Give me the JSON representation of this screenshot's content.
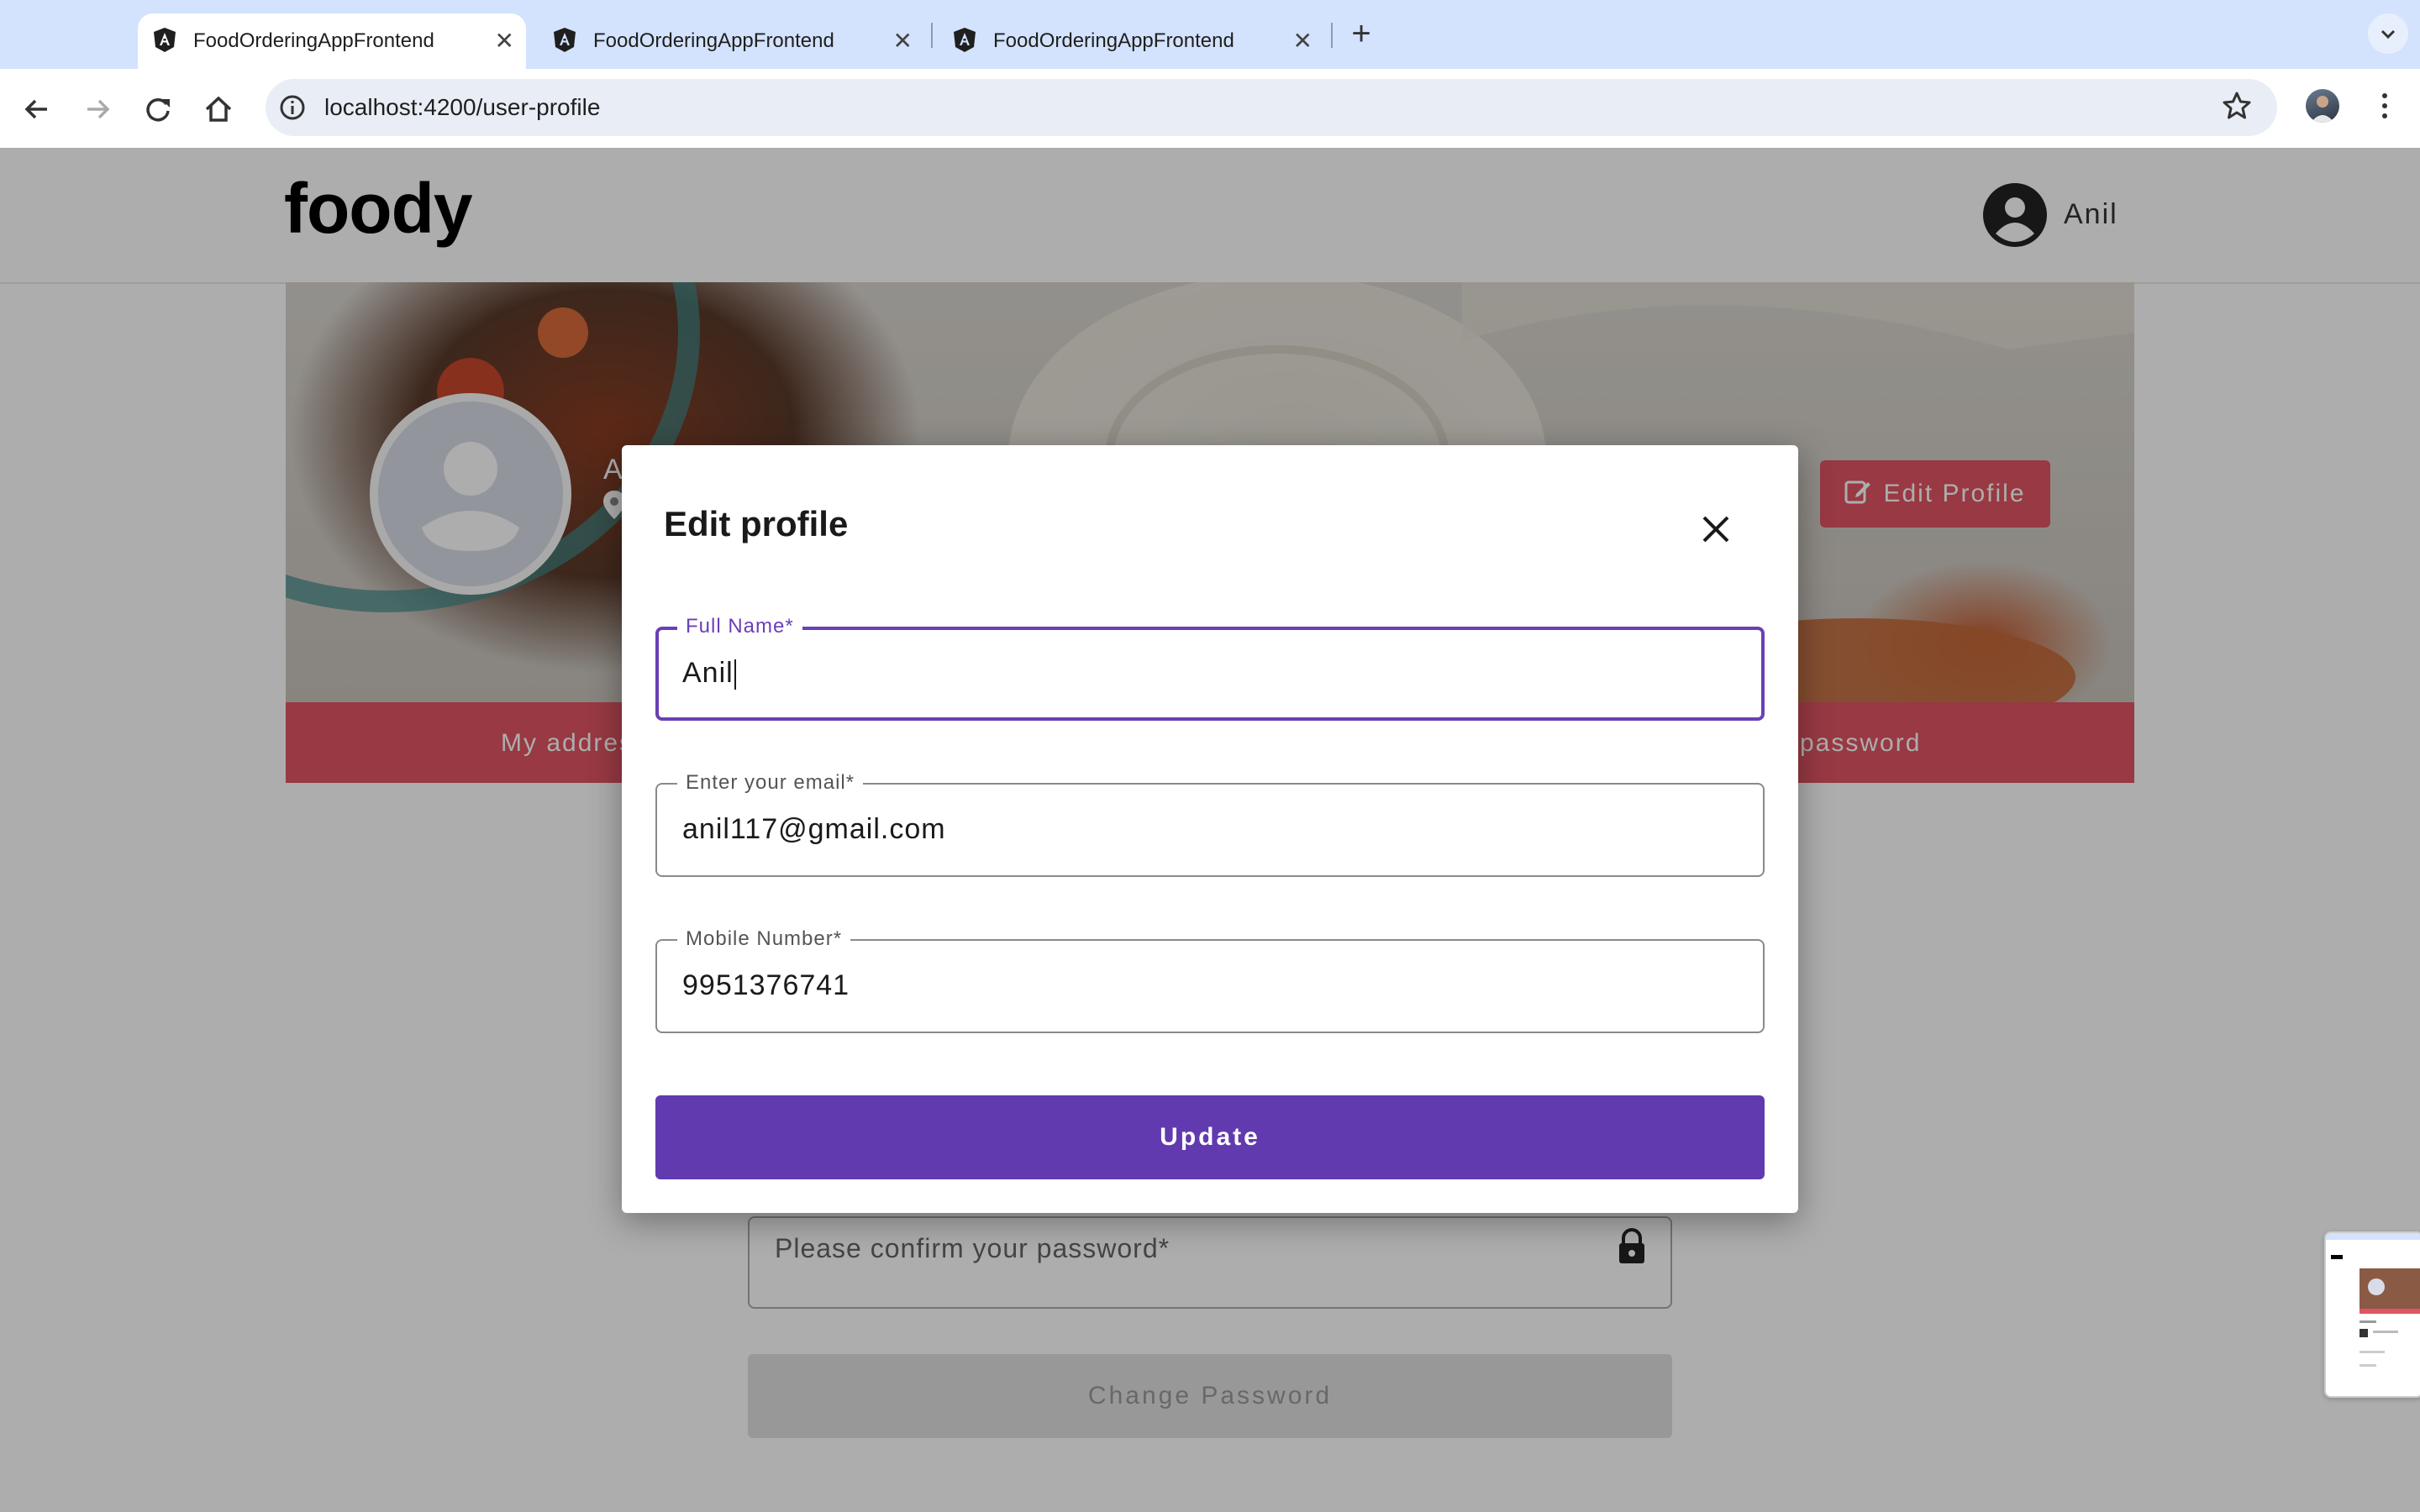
{
  "browser": {
    "tabs": [
      {
        "title": "FoodOrderingAppFrontend",
        "active": true
      },
      {
        "title": "FoodOrderingAppFrontend",
        "active": false
      },
      {
        "title": "FoodOrderingAppFrontend",
        "active": false
      }
    ],
    "url": "localhost:4200/user-profile"
  },
  "header": {
    "logo": "foody",
    "user_name": "Anil"
  },
  "profile": {
    "edit_profile_label": "Edit Profile",
    "strip_left": "My addres",
    "strip_right": "password",
    "name_initial": "A"
  },
  "password_form": {
    "confirm_placeholder": "Please confirm your password*",
    "change_password_label": "Change Password"
  },
  "dialog": {
    "title": "Edit profile",
    "fields": [
      {
        "label": "Full Name*",
        "value": "Anil"
      },
      {
        "label": "Enter your email*",
        "value": "anil117@gmail.com"
      },
      {
        "label": "Mobile Number*",
        "value": "9951376741"
      }
    ],
    "update_label": "Update"
  },
  "colors": {
    "accent_purple": "#613ab0",
    "brand_red": "#e05463",
    "tab_bar": "#d3e3fd"
  }
}
